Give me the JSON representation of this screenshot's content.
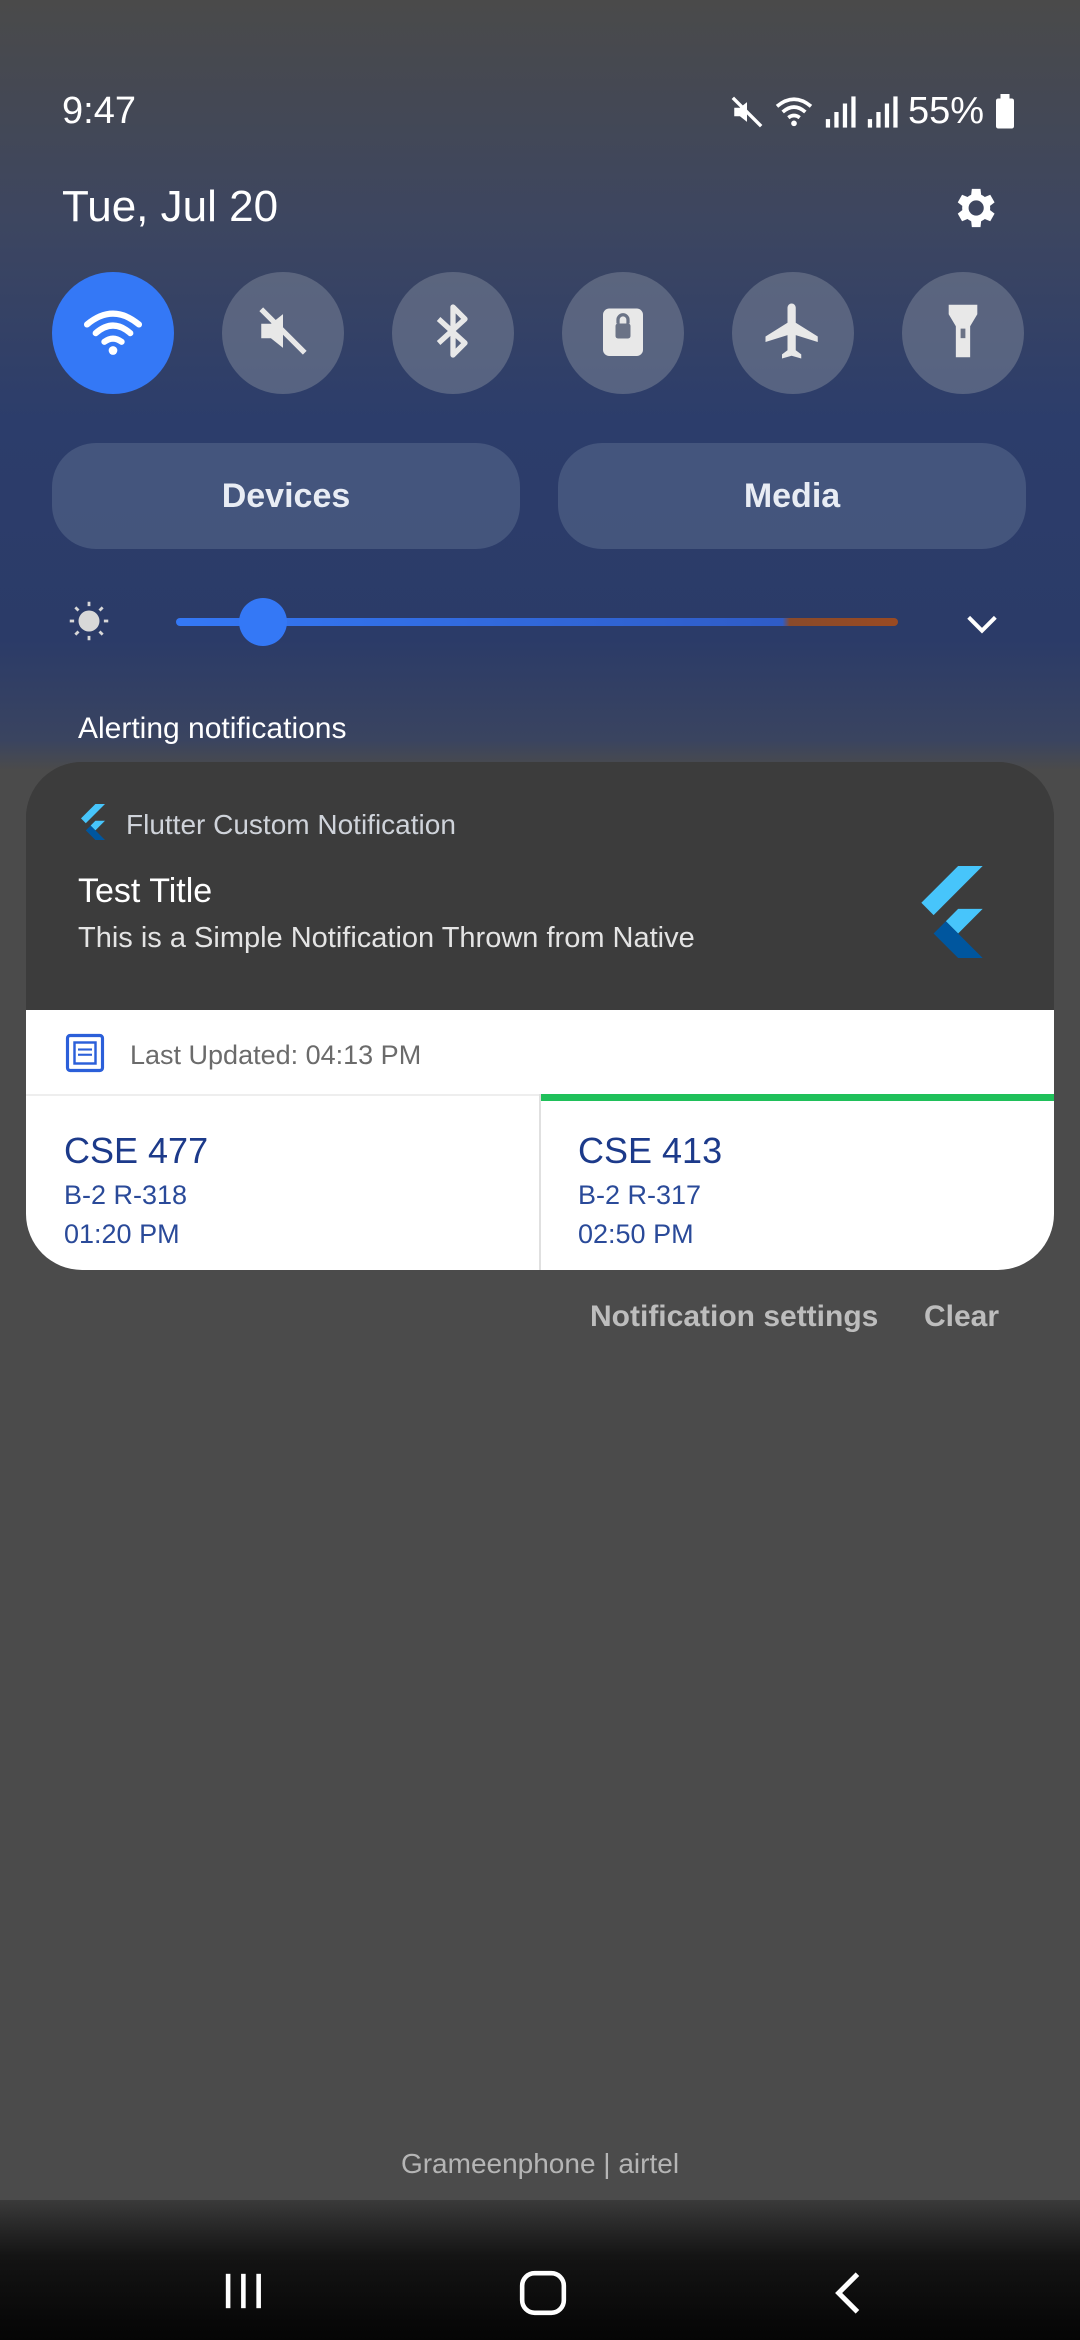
{
  "status_bar": {
    "time": "9:47",
    "battery_percent": "55%",
    "icons": [
      "mute-icon",
      "wifi-icon",
      "signal-icon",
      "signal-icon",
      "battery-icon"
    ]
  },
  "header": {
    "date": "Tue, Jul 20",
    "settings_icon": "gear-icon"
  },
  "quick_toggles": [
    {
      "name": "wifi",
      "icon": "wifi-icon",
      "on": true
    },
    {
      "name": "sound",
      "icon": "mute-icon",
      "on": false
    },
    {
      "name": "bluetooth",
      "icon": "bluetooth-icon",
      "on": false
    },
    {
      "name": "rotation-lock",
      "icon": "lock-rotation-icon",
      "on": false
    },
    {
      "name": "airplane",
      "icon": "airplane-icon",
      "on": false
    },
    {
      "name": "flashlight",
      "icon": "flashlight-icon",
      "on": false
    }
  ],
  "panel_buttons": {
    "devices": "Devices",
    "media": "Media"
  },
  "brightness": {
    "level": 0.12
  },
  "section_label": "Alerting notifications",
  "notification": {
    "app_name": "Flutter Custom Notification",
    "title": "Test Title",
    "body": "This is a Simple Notification Thrown from Native",
    "last_updated": "Last Updated: 04:13 PM",
    "courses": [
      {
        "code": "CSE 477",
        "room": "B-2 R-318",
        "time": "01:20 PM",
        "active": false
      },
      {
        "code": "CSE 413",
        "room": "B-2 R-317",
        "time": "02:50 PM",
        "active": true
      }
    ]
  },
  "actions": {
    "settings": "Notification settings",
    "clear": "Clear"
  },
  "carrier": "Grameenphone | airtel",
  "colors": {
    "accent": "#3478f6",
    "active_course": "#1fc05a",
    "course_text": "#1c3a8a"
  }
}
